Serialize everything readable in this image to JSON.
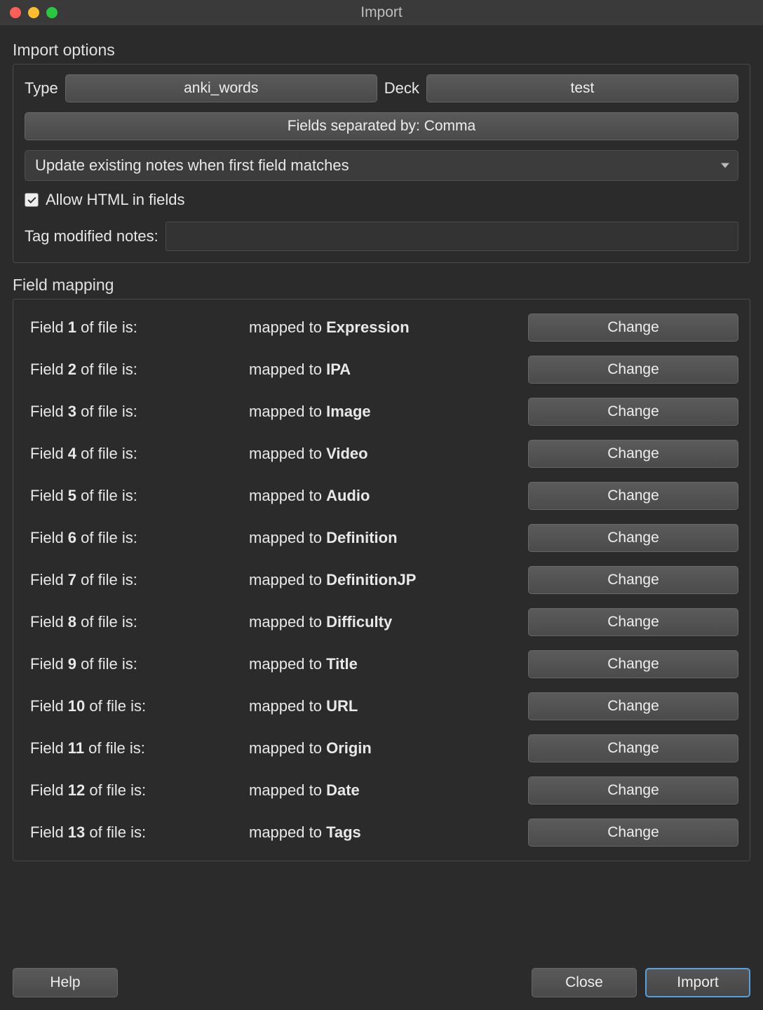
{
  "window": {
    "title": "Import"
  },
  "import_options": {
    "section_label": "Import options",
    "type_label": "Type",
    "type_value": "anki_words",
    "deck_label": "Deck",
    "deck_value": "test",
    "separator_button": "Fields separated by: Comma",
    "update_mode": "Update existing notes when first field matches",
    "allow_html_label": "Allow HTML in fields",
    "allow_html_checked": true,
    "tag_modified_label": "Tag modified notes:",
    "tag_modified_value": ""
  },
  "field_mapping": {
    "section_label": "Field mapping",
    "field_prefix": "Field ",
    "field_suffix": " of file is:",
    "mapped_prefix": "mapped to ",
    "change_label": "Change",
    "rows": [
      {
        "n": "1",
        "target": "Expression"
      },
      {
        "n": "2",
        "target": "IPA"
      },
      {
        "n": "3",
        "target": "Image"
      },
      {
        "n": "4",
        "target": "Video"
      },
      {
        "n": "5",
        "target": "Audio"
      },
      {
        "n": "6",
        "target": "Definition"
      },
      {
        "n": "7",
        "target": "DefinitionJP"
      },
      {
        "n": "8",
        "target": "Difficulty"
      },
      {
        "n": "9",
        "target": "Title"
      },
      {
        "n": "10",
        "target": "URL"
      },
      {
        "n": "11",
        "target": "Origin"
      },
      {
        "n": "12",
        "target": "Date"
      },
      {
        "n": "13",
        "target": "Tags"
      }
    ]
  },
  "footer": {
    "help": "Help",
    "close": "Close",
    "import": "Import"
  }
}
